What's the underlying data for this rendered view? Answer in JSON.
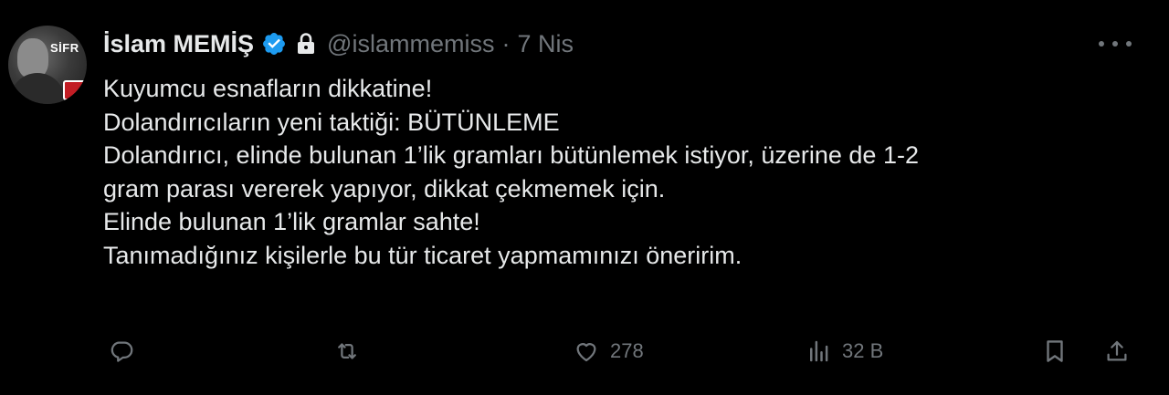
{
  "tweet": {
    "display_name": "İslam MEMİŞ",
    "handle": "@islammemiss",
    "separator": "·",
    "date": "7 Nis",
    "avatar_text": "SİFR",
    "lines": [
      "Kuyumcu esnafların dikkatine!",
      "Dolandırıcıların yeni taktiği: BÜTÜNLEME",
      "Dolandırıcı, elinde bulunan 1’lik gramları bütünlemek istiyor, üzerine de 1-2",
      "gram parası vererek yapıyor, dikkat çekmemek için.",
      "Elinde bulunan 1’lik gramlar sahte!",
      "Tanımadığınız kişilerle bu tür ticaret yapmamınızı öneririm."
    ]
  },
  "actions": {
    "reply": {
      "icon": "reply-icon",
      "count": ""
    },
    "repost": {
      "icon": "repost-icon",
      "count": ""
    },
    "like": {
      "icon": "heart-icon",
      "count": "278"
    },
    "views": {
      "icon": "views-icon",
      "count": "32 B"
    },
    "bookmark": {
      "icon": "bookmark-icon"
    },
    "share": {
      "icon": "share-icon"
    }
  },
  "colors": {
    "background": "#000000",
    "text": "#e7e9ea",
    "muted": "#71767b",
    "verified": "#1d9bf0"
  }
}
